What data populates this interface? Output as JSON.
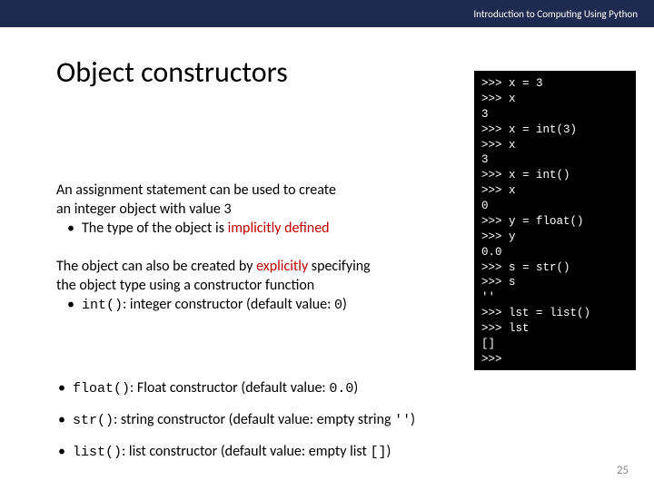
{
  "header": {
    "course": "Introduction to Computing Using Python"
  },
  "title": "Object constructors",
  "para1": {
    "line1": "An assignment statement can be used to create",
    "line2": "an integer object with value 3",
    "bullet_pre": "The type of the object is ",
    "bullet_red": "implicitly defined"
  },
  "para2": {
    "line1_pre": "The object can also be created by ",
    "line1_red": "explicitly",
    "line1_post": " specifying",
    "line2": "the object type using a constructor function",
    "bullet_code": "int()",
    "bullet_text": ": integer constructor (default value: ",
    "bullet_val": "0",
    "bullet_close": ")"
  },
  "bullets": {
    "float_code": "float()",
    "float_text": ": Float constructor (default value: ",
    "float_val": "0.0",
    "float_close": ")",
    "str_code": "str()",
    "str_text": ": string constructor (default value: empty string ",
    "str_val": "''",
    "str_close": ")",
    "list_code": "list()",
    "list_text": ": list constructor (default value: empty list ",
    "list_val": "[]",
    "list_close": ")"
  },
  "terminal": ">>> x = 3\n>>> x\n3\n>>> x = int(3)\n>>> x\n3\n>>> x = int()\n>>> x\n0\n>>> y = float()\n>>> y\n0.0\n>>> s = str()\n>>> s\n''\n>>> lst = list()\n>>> lst\n[]\n>>>",
  "page": "25"
}
